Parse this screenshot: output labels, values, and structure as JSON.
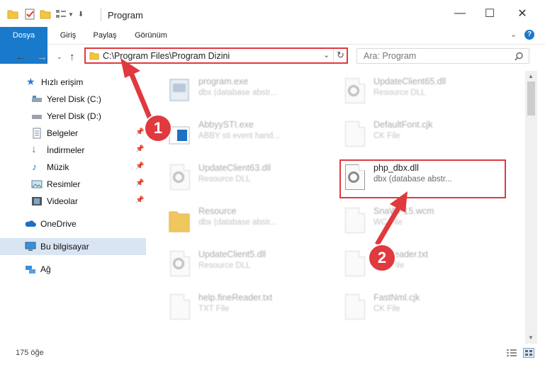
{
  "window": {
    "title": "Program",
    "minimize": "—",
    "maximize": "☐",
    "close": "✕"
  },
  "ribbon": {
    "tabs": [
      "Dosya",
      "Giriş",
      "Paylaş",
      "Görünüm"
    ]
  },
  "address": {
    "path": "C:\\Program Files\\Program Dizini",
    "search_placeholder": "Ara: Program"
  },
  "sidebar": {
    "items": [
      {
        "label": "Hızlı erişim",
        "icon": "star-icon"
      },
      {
        "label": "Yerel Disk (C:)",
        "icon": "drive-icon"
      },
      {
        "label": "Yerel Disk (D:)",
        "icon": "drive-icon"
      },
      {
        "label": "Belgeler",
        "icon": "documents-icon"
      },
      {
        "label": "İndirmeler",
        "icon": "download-icon"
      },
      {
        "label": "Müzik",
        "icon": "music-icon"
      },
      {
        "label": "Resimler",
        "icon": "pictures-icon"
      },
      {
        "label": "Videolar",
        "icon": "video-icon"
      },
      {
        "label": "OneDrive",
        "icon": "cloud-icon"
      },
      {
        "label": "Bu bilgisayar",
        "icon": "computer-icon"
      },
      {
        "label": "Ağ",
        "icon": "network-icon"
      }
    ]
  },
  "files": {
    "items": [
      {
        "name": "program.exe",
        "desc": "dbx (database abstr..."
      },
      {
        "name": "UpdateClient65.dll",
        "desc": "Resource DLL"
      },
      {
        "name": "AbbyySTI.exe",
        "desc": "ABBY sti event hand..."
      },
      {
        "name": "DefaultFont.cjk",
        "desc": "CK File"
      },
      {
        "name": "UpdateClient63.dll",
        "desc": "Resource DLL"
      },
      {
        "name": "php_dbx.dll",
        "desc": "dbx (database abstr..."
      },
      {
        "name": "Resource",
        "desc": "dbx (database abstr..."
      },
      {
        "name": "SnaWP15.wcm",
        "desc": "WC File"
      },
      {
        "name": "UpdateClient5.dll",
        "desc": "Resource DLL"
      },
      {
        "name": "fineReader.txt",
        "desc": "TXT File"
      },
      {
        "name": "help.fineReader.txt",
        "desc": "TXT File"
      },
      {
        "name": "FastNml.cjk",
        "desc": "CK File"
      }
    ]
  },
  "annotations": {
    "step1": "1",
    "step2": "2"
  },
  "status": {
    "count": "175 öğe"
  },
  "colors": {
    "accent": "#1979ca",
    "highlight": "#e0393e"
  }
}
